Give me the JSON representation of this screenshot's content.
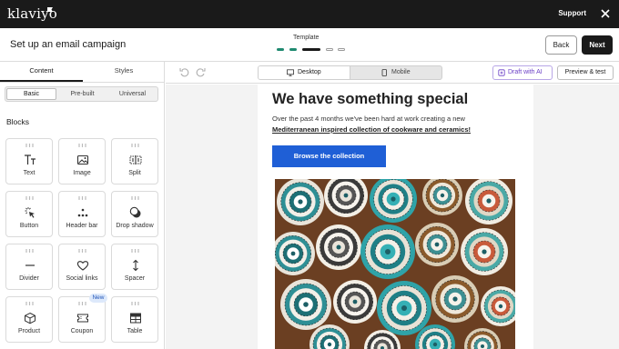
{
  "app": {
    "logo": "klaviyo",
    "support": "Support"
  },
  "header": {
    "title": "Set up an email campaign",
    "stepper_label": "Template",
    "back": "Back",
    "next": "Next"
  },
  "left_panel": {
    "tabs": [
      "Content",
      "Styles"
    ],
    "segments": [
      "Basic",
      "Pre-built",
      "Universal"
    ],
    "blocks_title": "Blocks",
    "blocks": [
      {
        "label": "Text",
        "icon": "text-icon"
      },
      {
        "label": "Image",
        "icon": "image-icon"
      },
      {
        "label": "Split",
        "icon": "split-icon"
      },
      {
        "label": "Button",
        "icon": "button-cursor-icon"
      },
      {
        "label": "Header bar",
        "icon": "header-bar-icon"
      },
      {
        "label": "Drop shadow",
        "icon": "drop-shadow-icon"
      },
      {
        "label": "Divider",
        "icon": "divider-icon"
      },
      {
        "label": "Social links",
        "icon": "heart-icon"
      },
      {
        "label": "Spacer",
        "icon": "spacer-icon"
      },
      {
        "label": "Product",
        "icon": "product-box-icon"
      },
      {
        "label": "Coupon",
        "icon": "coupon-icon"
      },
      {
        "label": "Table",
        "icon": "table-icon"
      }
    ],
    "new_badge": "New"
  },
  "toolbar": {
    "desktop": "Desktop",
    "mobile": "Mobile",
    "draft_ai": "Draft with AI",
    "preview": "Preview & test"
  },
  "email": {
    "headline": "We have something special",
    "body_line1": "Over the past 4 months we've been hard at work creating a new",
    "body_line2": "Mediterranean inspired collection of cookware and ceramics!",
    "cta": "Browse the collection",
    "image": "ceramic-bowls-photo"
  },
  "colors": {
    "topbar": "#1a1a1a",
    "cta": "#1f5fd6",
    "step_done": "#1f8a70",
    "step_current": "#1a1a1a",
    "ai_accent": "#6a3fc6",
    "new_badge_bg": "#dde9fb"
  }
}
